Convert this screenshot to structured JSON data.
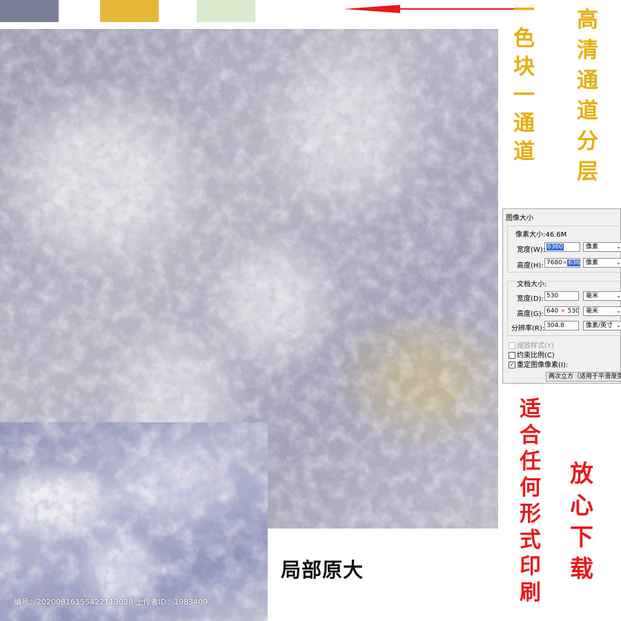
{
  "swatches": [
    {
      "name": "swatch-purple-gray",
      "color": "#7b7f98"
    },
    {
      "name": "swatch-gold",
      "color": "#e6b83a"
    },
    {
      "name": "swatch-light-green",
      "color": "#d9ebcc"
    }
  ],
  "arrow_color": "#e8181b",
  "vertical_texts": {
    "col1": [
      "一",
      "色",
      "块",
      "一",
      "通",
      "道"
    ],
    "col2": [
      "高",
      "清",
      "通",
      "道",
      "分",
      "层"
    ],
    "col3": [
      "适",
      "合",
      "任",
      "何",
      "形",
      "式",
      "印",
      "刷"
    ],
    "col4": [
      "放",
      "心",
      "下",
      "载"
    ]
  },
  "detail_label": "局部原大",
  "watermark": "编号：20200816155422113038 上传者ID：1983409",
  "dialog": {
    "title": "图像大小",
    "pixel_size": "像素大小:46.6M",
    "width_label": "宽度(W):",
    "width_value": "6360",
    "width_unit": "像素",
    "height_label": "高度(H):",
    "height_old": "7680",
    "height_value": "6360",
    "height_unit": "像素",
    "doc_size": "文档大小:",
    "doc_width_label": "宽度(D):",
    "doc_width_value": "530",
    "doc_width_unit": "毫米",
    "doc_height_label": "高度(G):",
    "doc_height_old": "640",
    "doc_height_value": "530",
    "doc_height_unit": "毫米",
    "resolution_label": "分辨率(R):",
    "resolution_value": "304.8",
    "resolution_unit": "像素/英寸",
    "scale_styles": "缩放样式(Y)",
    "constrain": "约束比例(C)",
    "resample": "重定图像像素(I):",
    "resample_checked": "✓",
    "method": "两次立方（适用于平滑渐变"
  }
}
